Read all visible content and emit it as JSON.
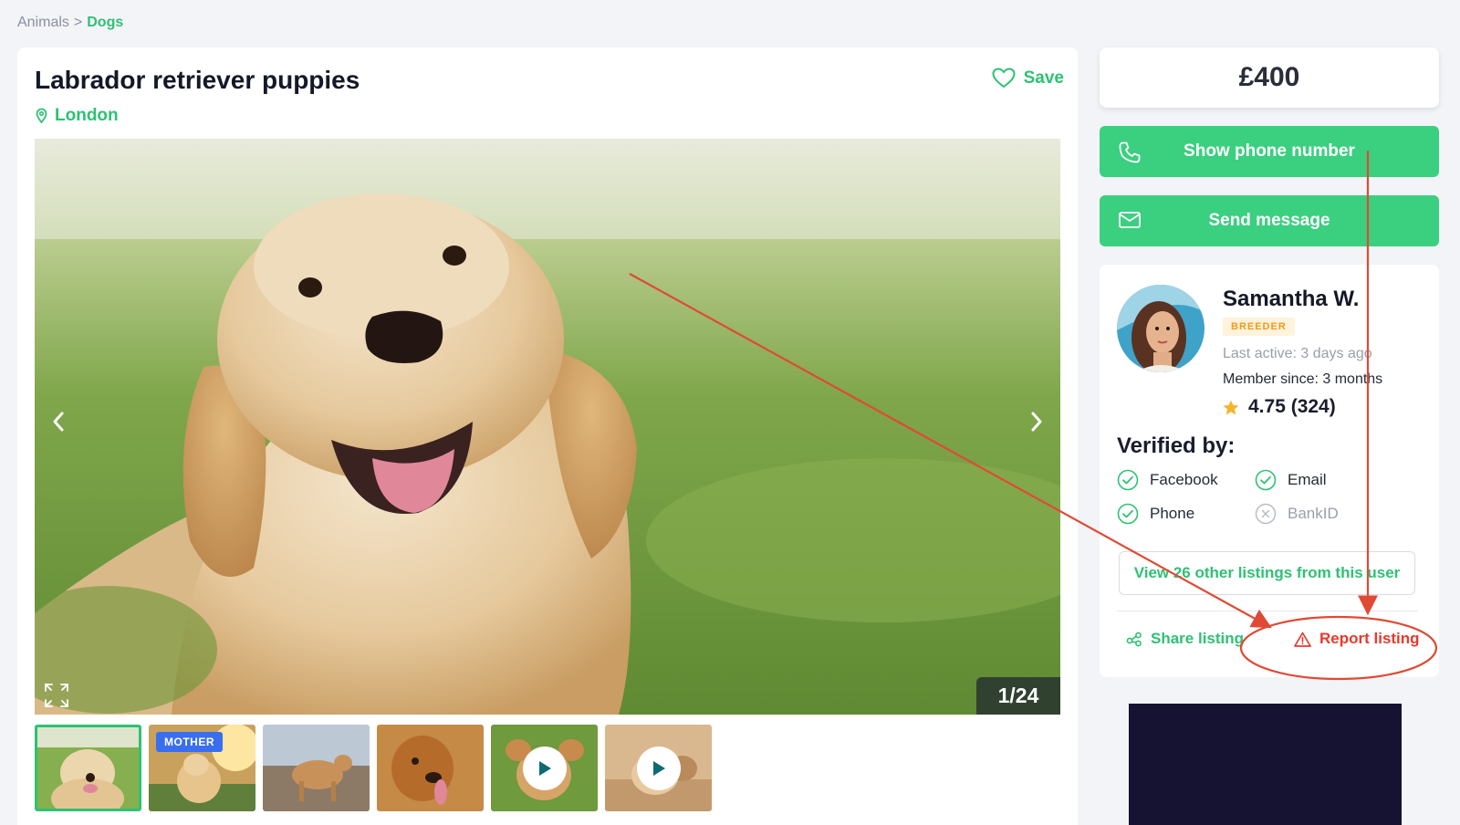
{
  "breadcrumb": {
    "parent": "Animals",
    "separator": ">",
    "current": "Dogs"
  },
  "listing": {
    "title": "Labrador retriever puppies",
    "location": "London",
    "save_label": "Save",
    "photo_counter": "1/24",
    "thumbnails": [
      {
        "badge": "",
        "video": false
      },
      {
        "badge": "MOTHER",
        "video": false
      },
      {
        "badge": "",
        "video": false
      },
      {
        "badge": "",
        "video": false
      },
      {
        "badge": "",
        "video": true
      },
      {
        "badge": "",
        "video": true
      }
    ]
  },
  "sidebar": {
    "price": "£400",
    "show_phone_label": "Show phone number",
    "send_message_label": "Send message",
    "seller": {
      "name": "Samantha W.",
      "badge": "BREEDER",
      "last_active": "Last active: 3 days ago",
      "member_since": "Member since: 3 months",
      "rating": "4.75 (324)"
    },
    "verified_title": "Verified by:",
    "verifications": [
      {
        "label": "Facebook",
        "verified": true
      },
      {
        "label": "Email",
        "verified": true
      },
      {
        "label": "Phone",
        "verified": true
      },
      {
        "label": "BankID",
        "verified": false
      }
    ],
    "view_listings_label": "View 26 other listings from this user",
    "share_label": "Share listing",
    "report_label": "Report listing"
  },
  "colors": {
    "accent_green": "#2ec174",
    "button_green": "#3bcf80",
    "report_red": "#e8392b",
    "annotation_red": "#e04a35"
  }
}
